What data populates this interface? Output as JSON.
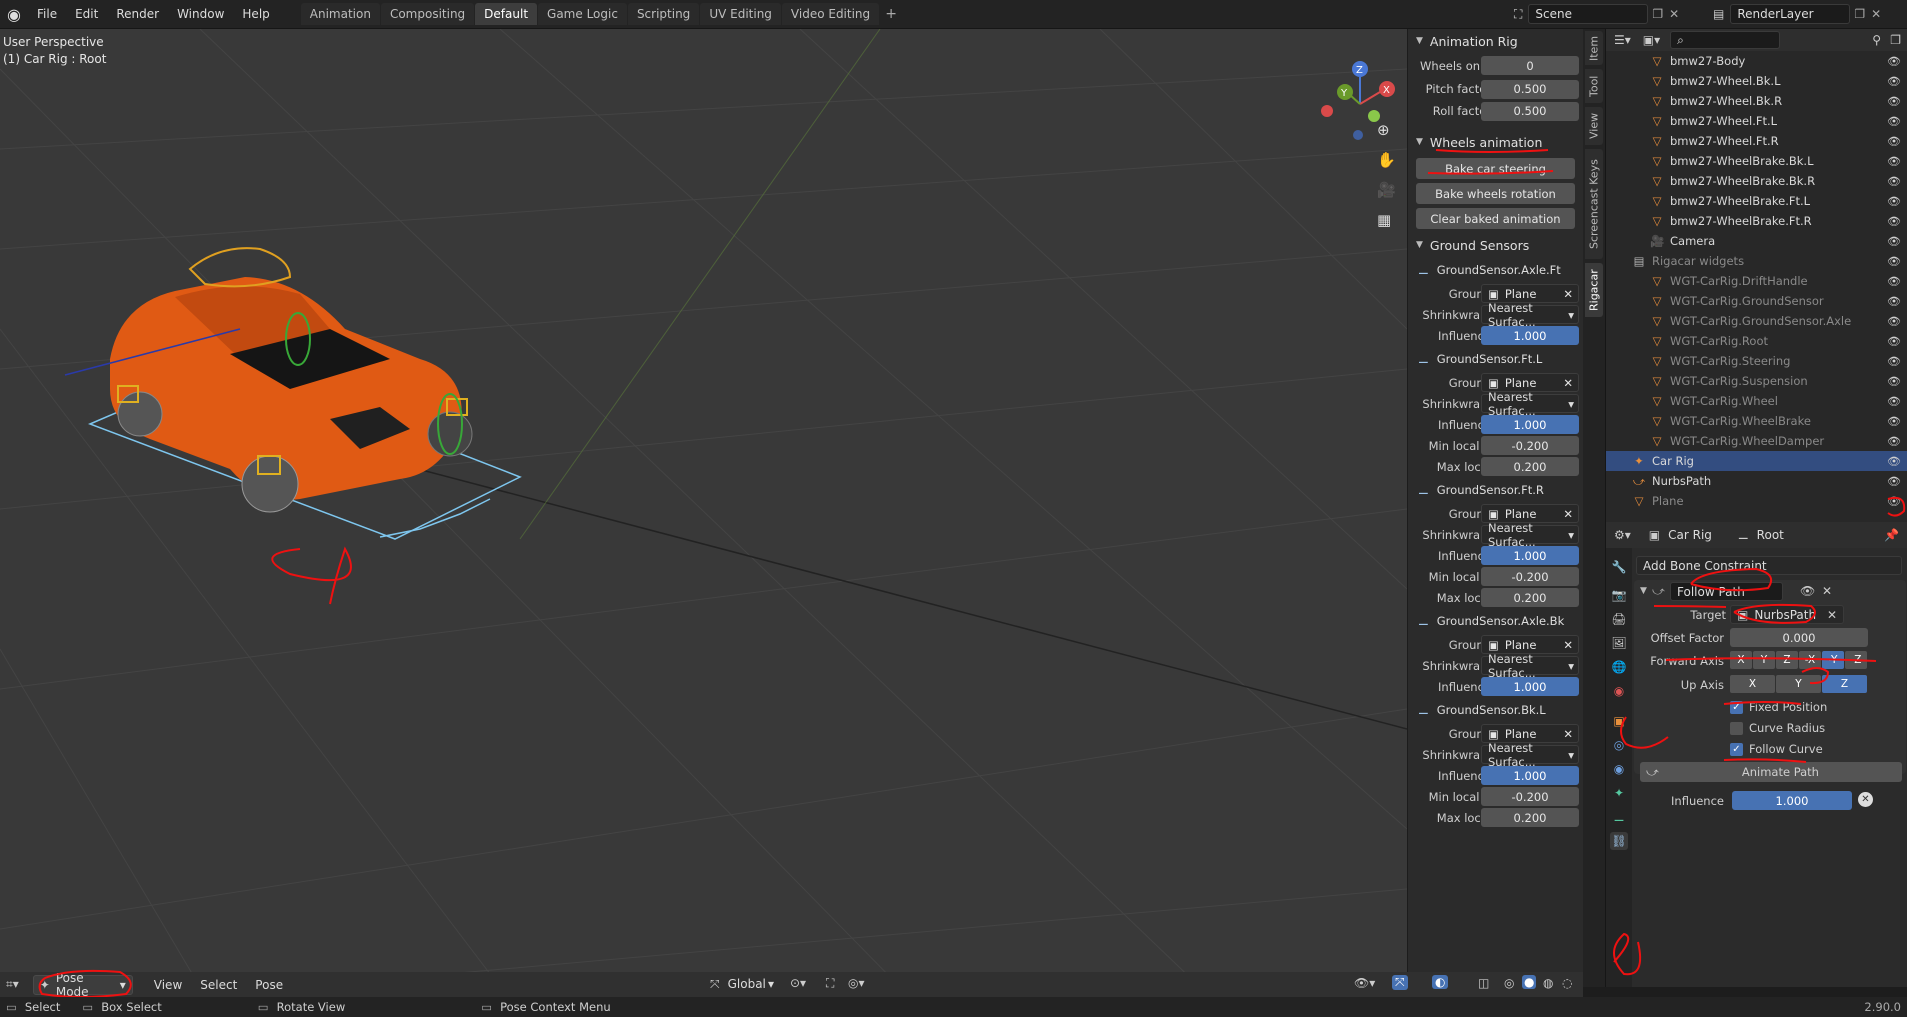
{
  "menubar": {
    "items": [
      "File",
      "Edit",
      "Render",
      "Window",
      "Help"
    ]
  },
  "workspaces": {
    "tabs": [
      "Animation",
      "Compositing",
      "Default",
      "Game Logic",
      "Scripting",
      "UV Editing",
      "Video Editing"
    ],
    "active": "Default"
  },
  "header": {
    "scene": "Scene",
    "renderlayer": "RenderLayer"
  },
  "viewport": {
    "perspective": "User Perspective",
    "active_object": "(1) Car Rig : Root",
    "mode": "Pose Mode",
    "menus": [
      "View",
      "Select",
      "Pose"
    ],
    "orientation": "Global"
  },
  "npanel": {
    "tabs": [
      "Item",
      "Tool",
      "View",
      "Screencast Keys",
      "Rigacar"
    ],
    "animation_rig": {
      "title": "Animation Rig",
      "rows": [
        {
          "label": "Wheels on...",
          "value": "0"
        },
        {
          "label": "Pitch factor",
          "value": "0.500"
        },
        {
          "label": "Roll factor",
          "value": "0.500"
        }
      ]
    },
    "wheels_animation": {
      "title": "Wheels animation",
      "buttons": [
        "Bake car steering",
        "Bake wheels rotation",
        "Clear baked animation"
      ]
    },
    "ground_sensors": {
      "title": "Ground Sensors",
      "sensors": [
        {
          "name": "GroundSensor.Axle.Ft",
          "ground": "Plane",
          "shrink": "Nearest Surfac...",
          "influence": "1.000"
        },
        {
          "name": "GroundSensor.Ft.L",
          "ground": "Plane",
          "shrink": "Nearest Surfac...",
          "influence": "1.000",
          "min": "-0.200",
          "max": "0.200"
        },
        {
          "name": "GroundSensor.Ft.R",
          "ground": "Plane",
          "shrink": "Nearest Surfac...",
          "influence": "1.000",
          "min": "-0.200",
          "max": "0.200"
        },
        {
          "name": "GroundSensor.Axle.Bk",
          "ground": "Plane",
          "shrink": "Nearest Surfac...",
          "influence": "1.000"
        },
        {
          "name": "GroundSensor.Bk.L",
          "ground": "Plane",
          "shrink": "Nearest Surfac...",
          "influence": "1.000",
          "min": "-0.200",
          "max": "0.200"
        }
      ],
      "labels": {
        "ground": "Ground",
        "shrink": "Shrinkwra...",
        "influence": "Influence",
        "min": "Min local Z",
        "max": "Max local"
      }
    }
  },
  "outliner": {
    "items": [
      {
        "name": "bmw27-Body",
        "type": "mesh",
        "indent": 2
      },
      {
        "name": "bmw27-Wheel.Bk.L",
        "type": "mesh",
        "indent": 2
      },
      {
        "name": "bmw27-Wheel.Bk.R",
        "type": "mesh",
        "indent": 2
      },
      {
        "name": "bmw27-Wheel.Ft.L",
        "type": "mesh",
        "indent": 2
      },
      {
        "name": "bmw27-Wheel.Ft.R",
        "type": "mesh",
        "indent": 2
      },
      {
        "name": "bmw27-WheelBrake.Bk.L",
        "type": "mesh",
        "indent": 2
      },
      {
        "name": "bmw27-WheelBrake.Bk.R",
        "type": "mesh",
        "indent": 2
      },
      {
        "name": "bmw27-WheelBrake.Ft.L",
        "type": "mesh",
        "indent": 2
      },
      {
        "name": "bmw27-WheelBrake.Ft.R",
        "type": "mesh",
        "indent": 2
      },
      {
        "name": "Camera",
        "type": "camera",
        "indent": 2
      },
      {
        "name": "Rigacar widgets",
        "type": "collection",
        "indent": 1
      },
      {
        "name": "WGT-CarRig.DriftHandle",
        "type": "mesh",
        "indent": 2
      },
      {
        "name": "WGT-CarRig.GroundSensor",
        "type": "mesh",
        "indent": 2
      },
      {
        "name": "WGT-CarRig.GroundSensor.Axle",
        "type": "mesh",
        "indent": 2
      },
      {
        "name": "WGT-CarRig.Root",
        "type": "mesh",
        "indent": 2
      },
      {
        "name": "WGT-CarRig.Steering",
        "type": "mesh",
        "indent": 2
      },
      {
        "name": "WGT-CarRig.Suspension",
        "type": "mesh",
        "indent": 2
      },
      {
        "name": "WGT-CarRig.Wheel",
        "type": "mesh",
        "indent": 2
      },
      {
        "name": "WGT-CarRig.WheelBrake",
        "type": "mesh",
        "indent": 2
      },
      {
        "name": "WGT-CarRig.WheelDamper",
        "type": "mesh",
        "indent": 2
      },
      {
        "name": "Car Rig",
        "type": "armature",
        "indent": 1
      },
      {
        "name": "NurbsPath",
        "type": "curve",
        "indent": 1
      },
      {
        "name": "Plane",
        "type": "mesh",
        "indent": 1
      }
    ]
  },
  "properties": {
    "breadcrumb": {
      "object": "Car Rig",
      "bone": "Root"
    },
    "add_constraint": "Add Bone Constraint",
    "constraint": {
      "name": "Follow Path",
      "target_label": "Target",
      "target": "NurbsPath",
      "offset_label": "Offset Factor",
      "offset": "0.000",
      "forward_label": "Forward Axis",
      "forward_axes": [
        "X",
        "Y",
        "Z",
        "-X",
        "-Y",
        "-Z"
      ],
      "forward_active": "-Y",
      "up_label": "Up Axis",
      "up_axes": [
        "X",
        "Y",
        "Z"
      ],
      "up_active": "Z",
      "fixed_position": "Fixed Position",
      "curve_radius": "Curve Radius",
      "follow_curve": "Follow Curve",
      "animate_path": "Animate Path",
      "influence_label": "Influence",
      "influence": "1.000"
    }
  },
  "statusbar": {
    "select": "Select",
    "box_select": "Box Select",
    "rotate_view": "Rotate View",
    "pose_context": "Pose Context Menu",
    "version": "2.90.0"
  }
}
